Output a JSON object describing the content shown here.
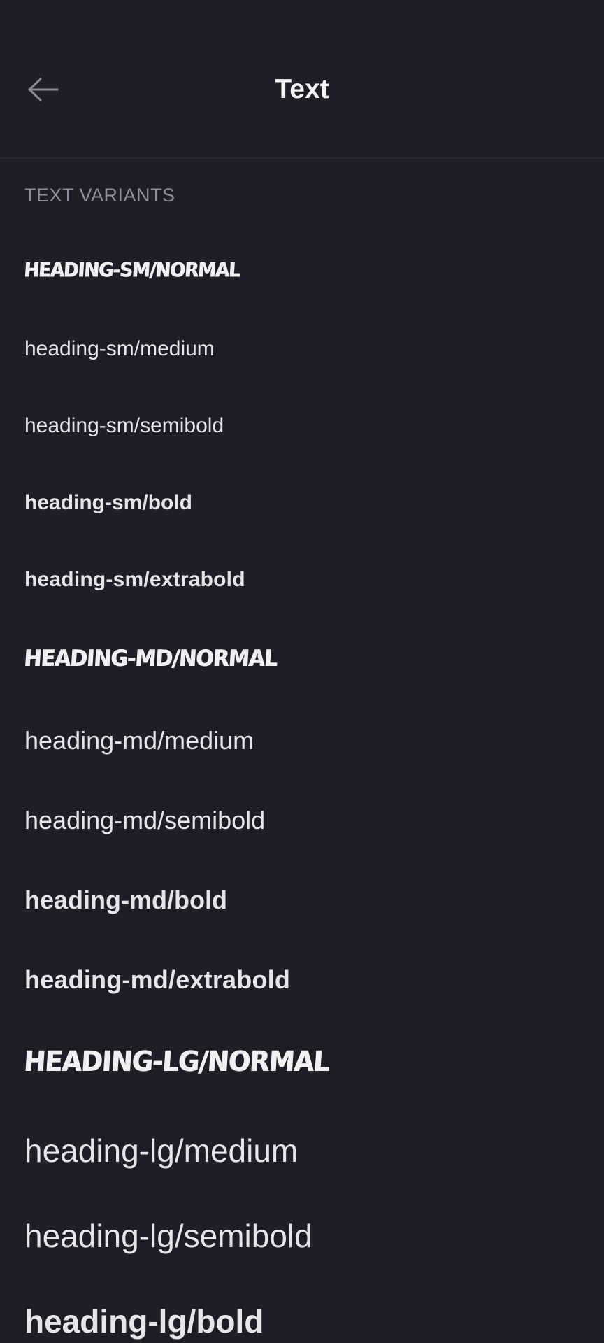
{
  "header": {
    "title": "Text",
    "back_icon": "arrow-left-icon"
  },
  "section": {
    "label": "TEXT VARIANTS"
  },
  "variants": [
    "heading-sm/normal",
    "heading-sm/medium",
    "heading-sm/semibold",
    "heading-sm/bold",
    "heading-sm/extrabold",
    "heading-md/normal",
    "heading-md/medium",
    "heading-md/semibold",
    "heading-md/bold",
    "heading-md/extrabold",
    "heading-lg/normal",
    "heading-lg/medium",
    "heading-lg/semibold",
    "heading-lg/bold"
  ],
  "colors": {
    "background": "#1e1f26",
    "text": "#e6e6ea",
    "muted": "#8e8f9a",
    "divider": "#2c2d35"
  }
}
